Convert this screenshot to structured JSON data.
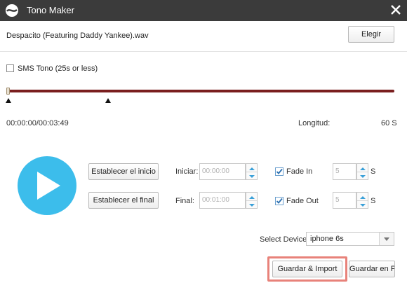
{
  "window": {
    "title": "Tono Maker",
    "logo_icon": "swirl-logo-icon",
    "close_icon": "close-icon"
  },
  "file": {
    "name": "Despacito (Featuring Daddy Yankee).wav",
    "choose_label": "Elegir"
  },
  "sms": {
    "label": "SMS Tono (25s or less)",
    "checked": false
  },
  "timeline": {
    "time_display": "00:00:00/00:03:49",
    "length_label": "Longitud:",
    "length_value": "60 S",
    "progress": 0
  },
  "controls": {
    "play_icon": "play-icon",
    "set_start_label": "Establecer el inicio",
    "set_end_label": "Establecer el final",
    "start_label": "Iniciar:",
    "start_value": "00:00:00",
    "end_label": "Final:",
    "end_value": "00:01:00",
    "fade_in_label": "Fade In",
    "fade_in_checked": true,
    "fade_in_value": "5",
    "fade_out_label": "Fade Out",
    "fade_out_checked": true,
    "fade_out_value": "5",
    "seconds_unit": "S"
  },
  "device": {
    "label": "Select Device:",
    "selected": "iphone 6s"
  },
  "actions": {
    "save_import_label": "Guardar & Import",
    "save_pc_label": "Guardar en PC"
  },
  "colors": {
    "titlebar": "#3b3b3b",
    "play_button": "#3cbdeb",
    "track": "#7a1e1e",
    "highlight": "#e8827a"
  }
}
